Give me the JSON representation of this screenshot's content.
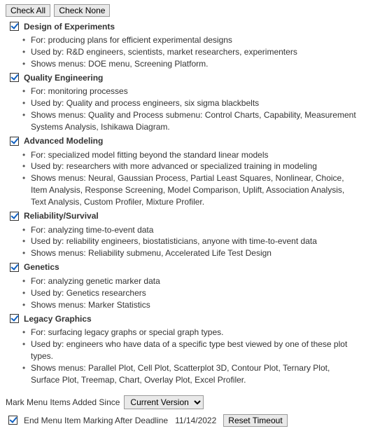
{
  "buttons": {
    "check_all": "Check All",
    "check_none": "Check None",
    "reset_timeout": "Reset Timeout"
  },
  "sections": [
    {
      "id": "design-of-experiments",
      "checked": true,
      "title": "Design of Experiments",
      "for": "For: producing plans for efficient experimental designs",
      "used_by": "Used by: R&D engineers, scientists, market researchers, experimenters",
      "shows": "Shows menus: DOE menu, Screening Platform."
    },
    {
      "id": "quality-engineering",
      "checked": true,
      "title": "Quality Engineering",
      "for": "For: monitoring processes",
      "used_by": "Used by: Quality and process engineers, six sigma blackbelts",
      "shows": "Shows menus: Quality and Process submenu: Control Charts, Capability, Measurement Systems Analysis, Ishikawa Diagram."
    },
    {
      "id": "advanced-modeling",
      "checked": true,
      "title": "Advanced Modeling",
      "for": "For: specialized model fitting beyond the standard linear models",
      "used_by": "Used by: researchers with more advanced or specialized training in modeling",
      "shows": "Shows menus: Neural, Gaussian Process, Partial Least Squares, Nonlinear, Choice, Item Analysis, Response Screening, Model Comparison, Uplift, Association Analysis, Text Analysis, Custom Profiler, Mixture Profiler."
    },
    {
      "id": "reliability-survival",
      "checked": true,
      "title": "Reliability/Survival",
      "for": "For: analyzing time-to-event data",
      "used_by": "Used by: reliability engineers, biostatisticians, anyone with time-to-event data",
      "shows": "Shows menus: Reliability submenu, Accelerated Life Test Design"
    },
    {
      "id": "genetics",
      "checked": true,
      "title": "Genetics",
      "for": "For: analyzing genetic marker data",
      "used_by": "Used by: Genetics researchers",
      "shows": "Shows menus: Marker Statistics"
    },
    {
      "id": "legacy-graphics",
      "checked": true,
      "title": "Legacy Graphics",
      "for": "For: surfacing legacy graphs or special graph types.",
      "used_by": "Used by: engineers who have data of a specific type best viewed by one of these plot types.",
      "shows": "Shows menus: Parallel Plot, Cell Plot, Scatterplot 3D, Contour Plot, Ternary Plot, Surface Plot, Treemap, Chart, Overlay Plot, Excel Profiler."
    }
  ],
  "bottom": {
    "mark_label": "Mark Menu Items Added Since",
    "version_selected": "Current Version",
    "version_options": [
      "Current Version"
    ],
    "end_marking_checked": true,
    "end_marking_label": "End Menu Item Marking After Deadline",
    "deadline_date": "11/14/2022"
  }
}
